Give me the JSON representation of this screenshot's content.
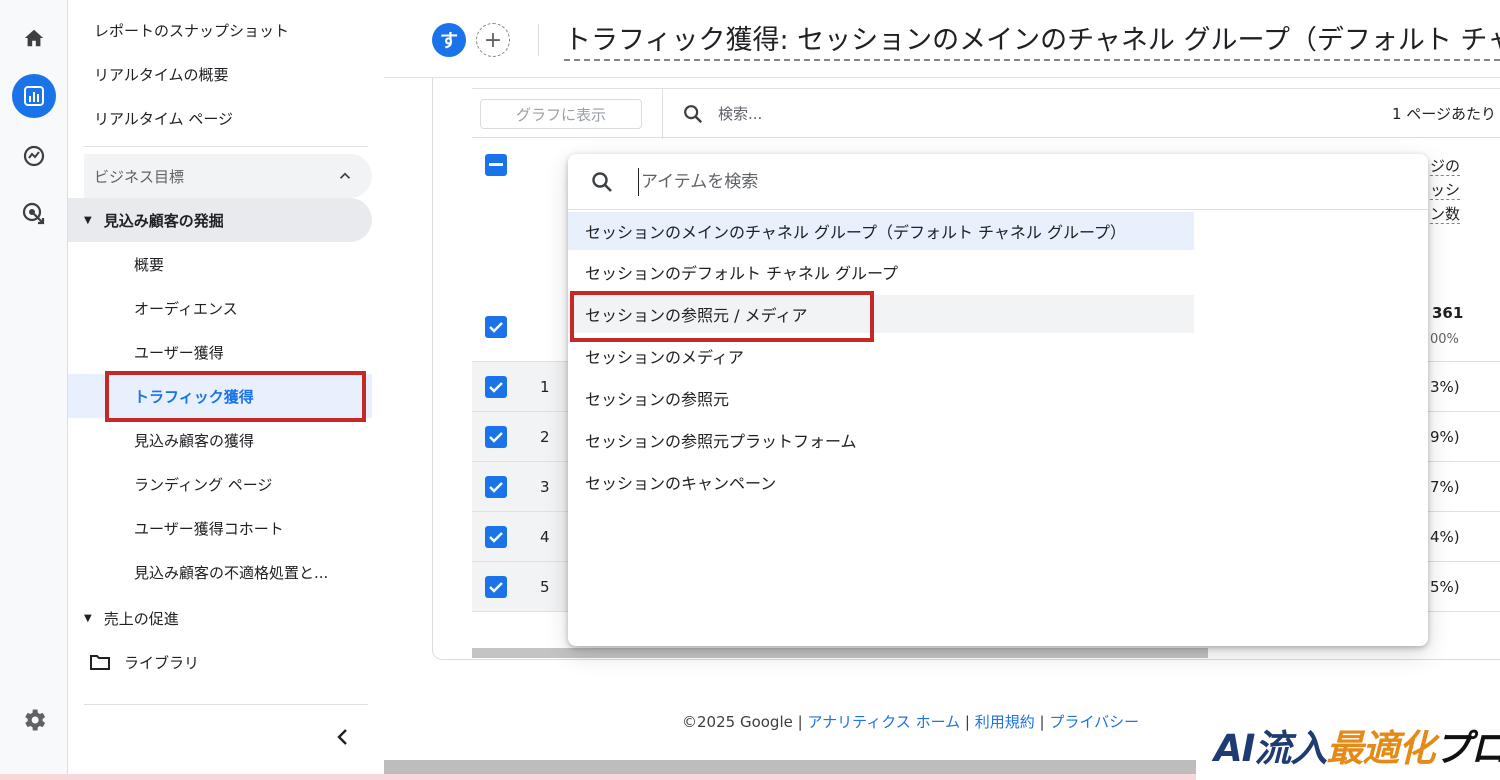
{
  "rail": {
    "icons": [
      "home-icon",
      "reports-icon",
      "explore-icon",
      "advertising-icon",
      "settings-icon"
    ],
    "active_color": "#1a73e8"
  },
  "nav": {
    "top_items": [
      "レポートのスナップショット",
      "リアルタイムの概要",
      "リアルタイム ページ"
    ],
    "section": {
      "label": "ビジネス目標"
    },
    "subsection1": {
      "label": "見込み顧客の発掘"
    },
    "children": [
      "概要",
      "オーディエンス",
      "ユーザー獲得",
      "トラフィック獲得",
      "見込み顧客の獲得",
      "ランディング ページ",
      "ユーザー獲得コホート",
      "見込み顧客の不適格処置と..."
    ],
    "subsection2": {
      "label": "売上の促進"
    },
    "library": "ライブラリ"
  },
  "header": {
    "avatar_letter": "す",
    "add_label": "+",
    "title": "トラフィック獲得: セッションのメインのチャネル グループ（デフォルト チャ"
  },
  "toolbar": {
    "graph_button": "グラフに表示",
    "search_placeholder": "検索...",
    "per_page": "1 ページあたり"
  },
  "table": {
    "column_head": [
      "ジの",
      "ッシ",
      "ン数"
    ],
    "total": "361",
    "total_pct": "00%",
    "rows": [
      {
        "num": "1",
        "pct": "3%)"
      },
      {
        "num": "2",
        "pct": "9%)"
      },
      {
        "num": "3",
        "pct": "7%)"
      },
      {
        "num": "4",
        "pct": "4%)"
      },
      {
        "num": "5",
        "pct": "5%)"
      }
    ]
  },
  "dropdown": {
    "placeholder": "アイテムを検索",
    "items": [
      "セッションのメインのチャネル グループ（デフォルト チャネル グループ）",
      "セッションのデフォルト チャネル グループ",
      "セッションの参照元 / メディア",
      "セッションのメディア",
      "セッションの参照元",
      "セッションの参照元プラットフォーム",
      "セッションのキャンペーン"
    ]
  },
  "footer": {
    "copyright": "©2025 Google |",
    "link_home": "アナリティクス ホーム",
    "sep1": "|",
    "link_terms": "利用規約",
    "sep2": "|",
    "link_privacy": "プライバシー"
  },
  "logo": {
    "part1": "AI流入",
    "part2": "最適化",
    "part3": "プロ"
  },
  "colors": {
    "accent": "#1a73e8",
    "highlight": "#c62828",
    "logo_navy": "#1f3b73",
    "logo_orange": "#e58a16"
  }
}
